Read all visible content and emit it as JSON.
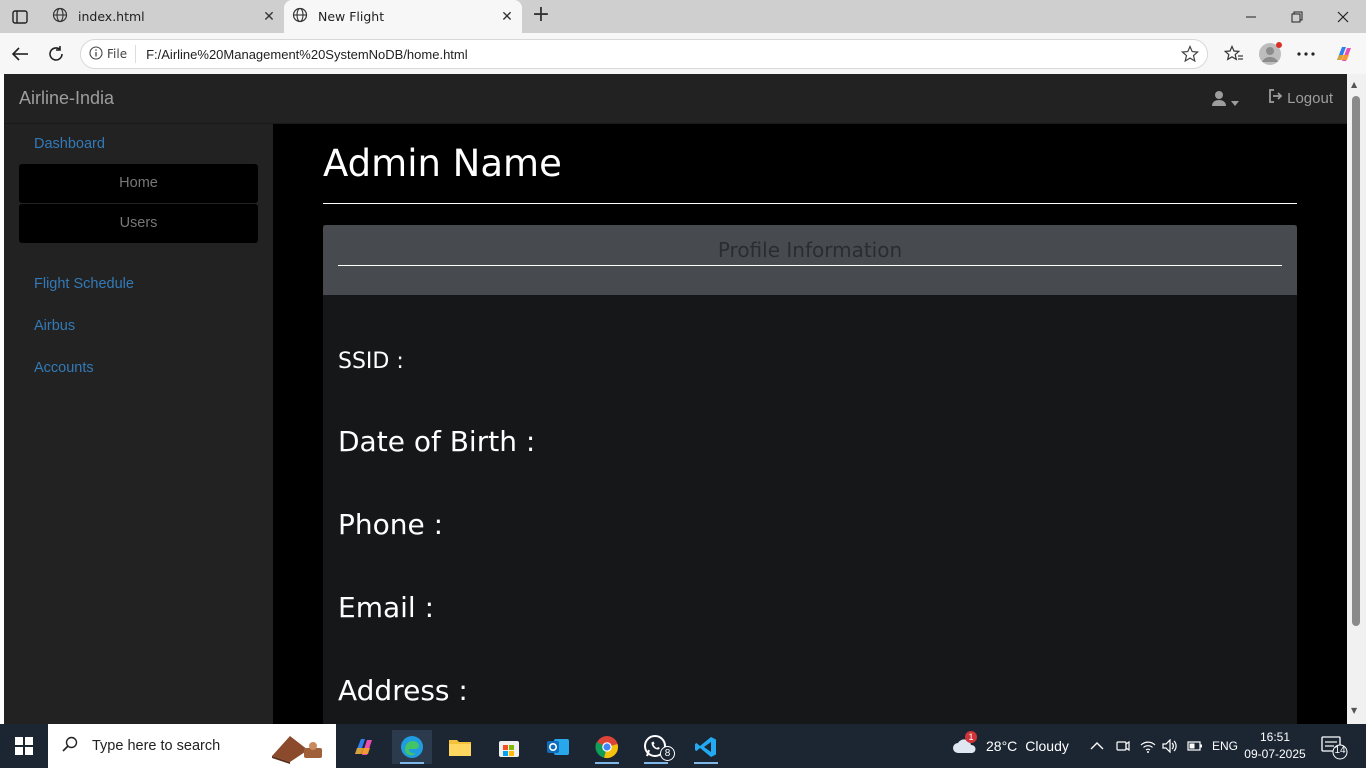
{
  "browser": {
    "tabs": [
      {
        "title": "index.html",
        "active": false
      },
      {
        "title": "New Flight",
        "active": true
      }
    ],
    "address": {
      "scheme_label": "File",
      "url": "F:/Airline%20Management%20SystemNoDB/home.html"
    },
    "icons": [
      "tab-actions-icon",
      "globe-icon",
      "close-icon",
      "new-tab-icon",
      "minimize-icon",
      "restore-icon",
      "window-close-icon",
      "back-icon",
      "refresh-icon",
      "info-icon",
      "favorite-star-icon",
      "favorites-icon",
      "profile-icon",
      "more-icon",
      "copilot-icon"
    ]
  },
  "app": {
    "brand": "Airline-India",
    "logout_label": "Logout",
    "sidebar": {
      "dashboard": "Dashboard",
      "dashboard_sub": [
        "Home",
        "Users"
      ],
      "items": [
        "Flight Schedule",
        "Airbus",
        "Accounts"
      ]
    },
    "main": {
      "heading": "Admin Name",
      "panel_title": "Profile Information",
      "fields": [
        {
          "label": "SSID :"
        },
        {
          "label": "Date of Birth :"
        },
        {
          "label": "Phone :"
        },
        {
          "label": "Email :"
        },
        {
          "label": "Address :"
        }
      ]
    },
    "colors": {
      "link": "#337ab7",
      "navbar_bg": "#222222",
      "main_bg": "#000000",
      "panel_head_bg": "#474b4f"
    }
  },
  "taskbar": {
    "search_placeholder": "Type here to search",
    "whatsapp_badge": "8",
    "weather": {
      "temp": "28°C",
      "condition": "Cloudy",
      "alert_badge": "1"
    },
    "language": "ENG",
    "time": "16:51",
    "date": "09-07-2025",
    "notification_count": "14"
  }
}
